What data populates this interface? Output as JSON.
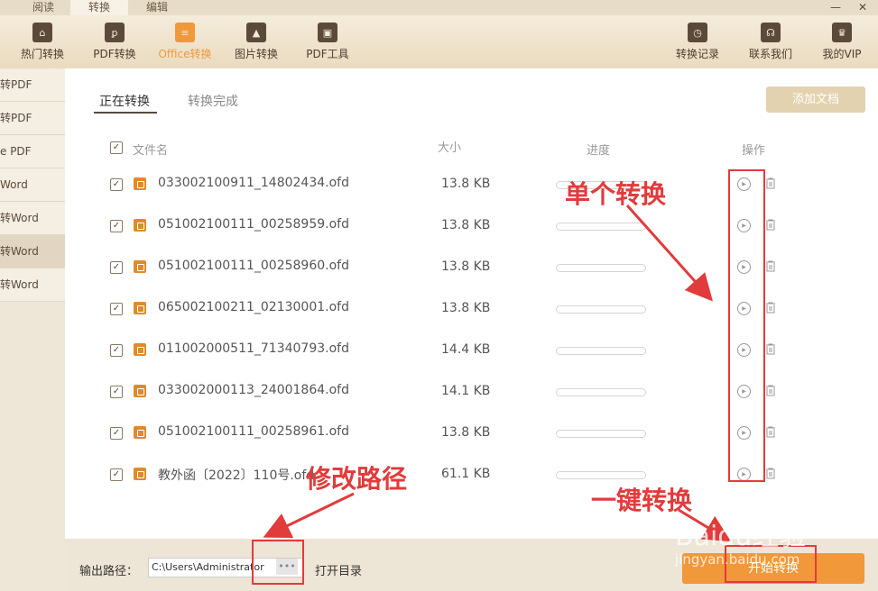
{
  "top_tabs": [
    "阅读",
    "转换",
    "编辑"
  ],
  "window_controls": {
    "minimize": "—",
    "close": "✕"
  },
  "toolbar_left": [
    {
      "label": "热门转换",
      "icon": "house-icon",
      "glyph": "⌂"
    },
    {
      "label": "PDF转换",
      "icon": "pdf-icon",
      "glyph": "ꝑ"
    },
    {
      "label": "Office转换",
      "icon": "office-doc-icon",
      "glyph": "≡",
      "active": true
    },
    {
      "label": "图片转换",
      "icon": "image-icon",
      "glyph": "▲"
    },
    {
      "label": "PDF工具",
      "icon": "toolbox-icon",
      "glyph": "▣"
    }
  ],
  "toolbar_right": [
    {
      "label": "转换记录",
      "icon": "clock-icon",
      "glyph": "◷"
    },
    {
      "label": "联系我们",
      "icon": "headset-icon",
      "glyph": "☊"
    },
    {
      "label": "我的VIP",
      "icon": "crown-icon",
      "glyph": "♛"
    }
  ],
  "sidebar": [
    "转PDF",
    "转PDF",
    "e PDF",
    "Word",
    "转Word",
    "转Word",
    "转Word"
  ],
  "subtabs": {
    "active": "正在转换",
    "done": "转换完成"
  },
  "add_button": "添加文档",
  "headers": {
    "filename": "文件名",
    "size": "大小",
    "progress": "进度",
    "action": "操作"
  },
  "files": [
    {
      "name": "033002100911_14802434.ofd",
      "size": "13.8 KB",
      "progress": 0
    },
    {
      "name": "051002100111_00258959.ofd",
      "size": "13.8 KB",
      "progress": 0
    },
    {
      "name": "051002100111_00258960.ofd",
      "size": "13.8 KB",
      "progress": 0
    },
    {
      "name": "065002100211_02130001.ofd",
      "size": "13.8 KB",
      "progress": 0
    },
    {
      "name": "011002000511_71340793.ofd",
      "size": "14.4 KB",
      "progress": 0
    },
    {
      "name": "033002000113_24001864.ofd",
      "size": "14.1 KB",
      "progress": 0
    },
    {
      "name": "051002100111_00258961.ofd",
      "size": "13.8 KB",
      "progress": 0
    },
    {
      "name": "教外函〔2022〕110号.ofd",
      "size": "61.1 KB",
      "progress": 0
    }
  ],
  "bottom": {
    "output_label": "输出路径：",
    "path_value": "C:\\Users\\Administrator",
    "more": "•••",
    "open_dir": "打开目录",
    "start": "开始转换"
  },
  "annotations": {
    "single": "单个转换",
    "path": "修改路径",
    "onekey": "一键转换",
    "color": "#e23b3b"
  },
  "watermark": {
    "brand": "Baidu经验",
    "url": "jingyan.baidu.com"
  }
}
